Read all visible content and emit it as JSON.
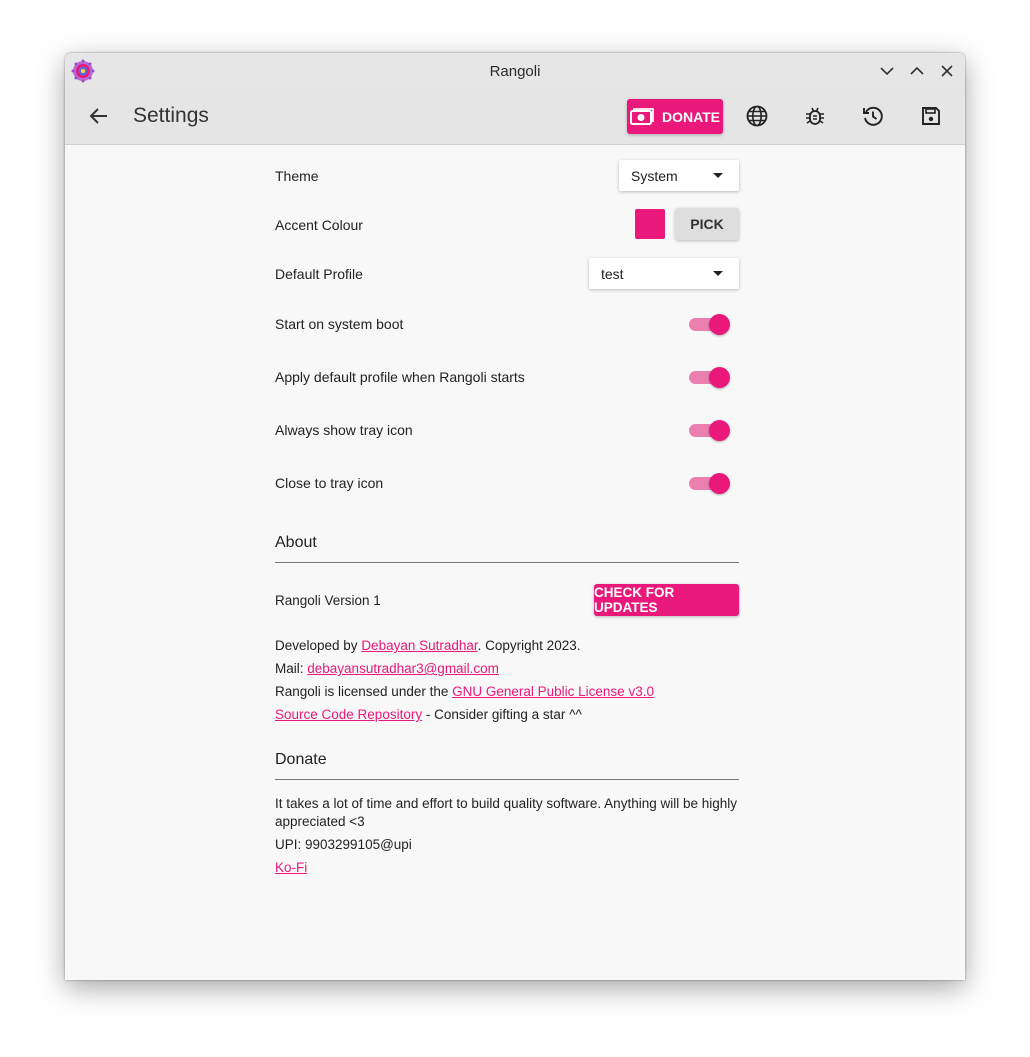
{
  "window": {
    "title": "Rangoli"
  },
  "toolbar": {
    "title": "Settings",
    "donate_label": "DONATE"
  },
  "settings": {
    "theme": {
      "label": "Theme",
      "value": "System"
    },
    "accent": {
      "label": "Accent Colour",
      "color": "#e9187a",
      "pick_label": "PICK"
    },
    "profile": {
      "label": "Default Profile",
      "value": "test"
    },
    "toggles": [
      {
        "label": "Start on system boot",
        "on": true
      },
      {
        "label": "Apply default profile when Rangoli starts",
        "on": true
      },
      {
        "label": "Always show tray icon",
        "on": true
      },
      {
        "label": "Close to tray icon",
        "on": true
      }
    ]
  },
  "about": {
    "heading": "About",
    "version": "Rangoli Version 1",
    "update_label": "CHECK FOR UPDATES",
    "dev_prefix": "Developed by ",
    "dev_name": "Debayan Sutradhar",
    "dev_suffix": ". Copyright 2023.",
    "mail_prefix": "Mail: ",
    "mail": "debayansutradhar3@gmail.com",
    "license_prefix": "Rangoli is licensed under the ",
    "license": "GNU General Public License v3.0",
    "repo": "Source Code Repository",
    "repo_suffix": " - Consider gifting a star ^^"
  },
  "donate": {
    "heading": "Donate",
    "text": "It takes a lot of time and effort to build quality software. Anything will be highly appreciated <3",
    "upi": "UPI: 9903299105@upi",
    "kofi": "Ko-Fi"
  },
  "colors": {
    "accent": "#e9187a",
    "accent_light": "#eb7fb0"
  }
}
